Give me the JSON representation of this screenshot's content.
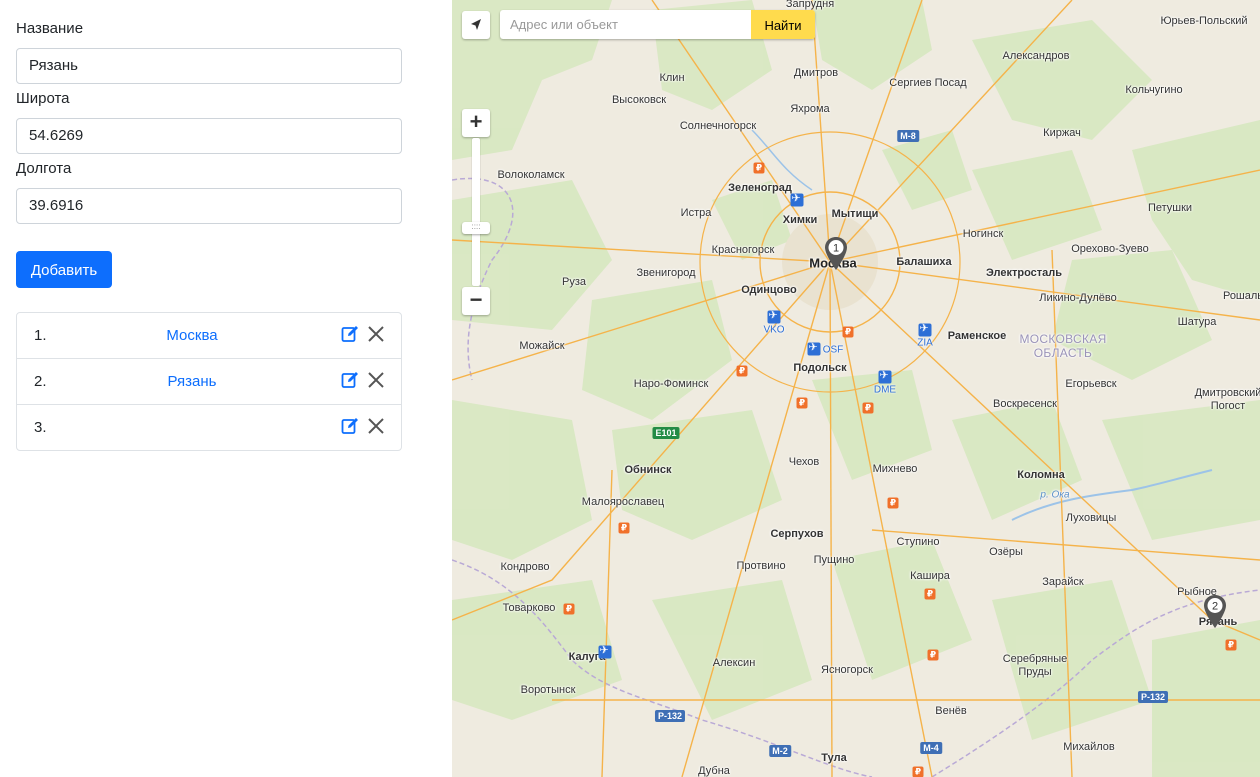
{
  "form": {
    "name_label": "Название",
    "name_value": "Рязань",
    "lat_label": "Широта",
    "lat_value": "54.6269",
    "lon_label": "Долгота",
    "lon_value": "39.6916",
    "add_button": "Добавить"
  },
  "points": [
    {
      "num": "1.",
      "name": "Москва"
    },
    {
      "num": "2.",
      "name": "Рязань"
    },
    {
      "num": "3.",
      "name": ""
    }
  ],
  "map": {
    "search_placeholder": "Адрес или объект",
    "search_button": "Найти",
    "markers": [
      "1",
      "2"
    ],
    "colors": {
      "accent": "#0d6efd",
      "search_button": "#ffdb4d",
      "marker": "#555555"
    },
    "labels": {
      "zaprudnya": "Запрудня",
      "yuryev": "Юрьев-Польский",
      "aleksandrov": "Александров",
      "klin": "Клин",
      "dmitrov": "Дмитров",
      "sergiev": "Сергиев Посад",
      "vysokovsk": "Высоковск",
      "yakhroma": "Яхрома",
      "kolchugino": "Кольчугино",
      "solnechnogorsk": "Солнечногорск",
      "kirzhach": "Киржач",
      "volokolamsk": "Волоколамск",
      "zelenograd": "Зеленоград",
      "istra": "Истра",
      "khimki": "Химки",
      "mytishchi": "Мытищи",
      "petushki": "Петушки",
      "noginsk": "Ногинск",
      "krasnogorsk": "Красногорск",
      "moskva": "Москва",
      "balashikha": "Балашиха",
      "orekhovo": "Орехово-Зуево",
      "ruza": "Руза",
      "zvenigorod": "Звенигород",
      "elektrostal": "Электросталь",
      "odintsovo": "Одинцово",
      "likino": "Ликино-Дулёво",
      "roshal": "Рошаль",
      "shatura": "Шатура",
      "ramenskoe": "Раменское",
      "mozhaysk": "Можайск",
      "region": "МОСКОВСКАЯ ОБЛАСТЬ",
      "podolsk": "Подольск",
      "naro": "Наро-Фоминск",
      "egoryevsk": "Егорьевск",
      "dmitrovsky": "Дмитровский Погост",
      "voskresensk": "Воскресенск",
      "obninsk": "Обнинск",
      "chekhov": "Чехов",
      "mikhnevo": "Михнево",
      "kolomna": "Коломна",
      "maloyaroslavets": "Малоярославец",
      "oka": "р. Ока",
      "lukhovitsy": "Луховицы",
      "serpukhov": "Серпухов",
      "stupino": "Ступино",
      "kondrovo": "Кондрово",
      "protvino": "Протвино",
      "pushchino": "Пущино",
      "ozery": "Озёры",
      "zaraysk": "Зарайск",
      "kashira": "Кашира",
      "rybnoe": "Рыбное",
      "ryazan": "Рязань",
      "tovarkovo": "Товарково",
      "kaluga": "Калуга",
      "aleksin": "Алексин",
      "serebryanye": "Серебряные Пруды",
      "yasnogorsk": "Ясногорск",
      "vorotynsk": "Воротынск",
      "venev": "Венёв",
      "mikhaylov": "Михайлов",
      "tula": "Тула",
      "dubna": "Дубна"
    },
    "airports": {
      "vko": "VKO",
      "osf": "OSF",
      "zia": "ZIA",
      "dme": "DME"
    },
    "roads": {
      "e101": "E101",
      "r132a": "Р-132",
      "r132b": "Р-132",
      "m2": "М-2",
      "m4": "М-4",
      "m8": "М-8"
    }
  }
}
